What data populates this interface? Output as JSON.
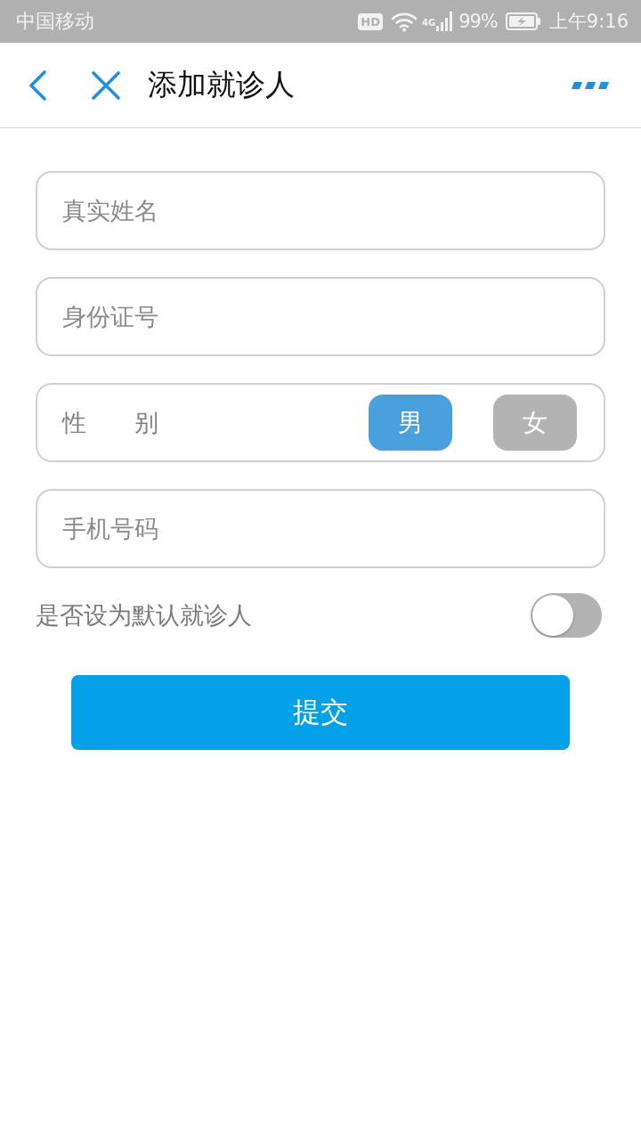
{
  "status_bar": {
    "carrier": "中国移动",
    "hd_badge": "HD",
    "network_type": "4G",
    "battery_percent": "99%",
    "time": "上午9:16"
  },
  "header": {
    "title": "添加就诊人"
  },
  "form": {
    "rows": [
      {
        "kind": "input",
        "placeholder": "真实姓名"
      },
      {
        "kind": "input",
        "placeholder": "身份证号"
      },
      {
        "kind": "choice",
        "label": "性　　别",
        "options": [
          {
            "label": "男",
            "selected": true
          },
          {
            "label": "女",
            "selected": false
          }
        ]
      },
      {
        "kind": "input",
        "placeholder": "手机号码"
      }
    ]
  },
  "default_toggle": {
    "label": "是否设为默认就诊人",
    "on": false
  },
  "submit_button": {
    "label": "提交"
  }
}
